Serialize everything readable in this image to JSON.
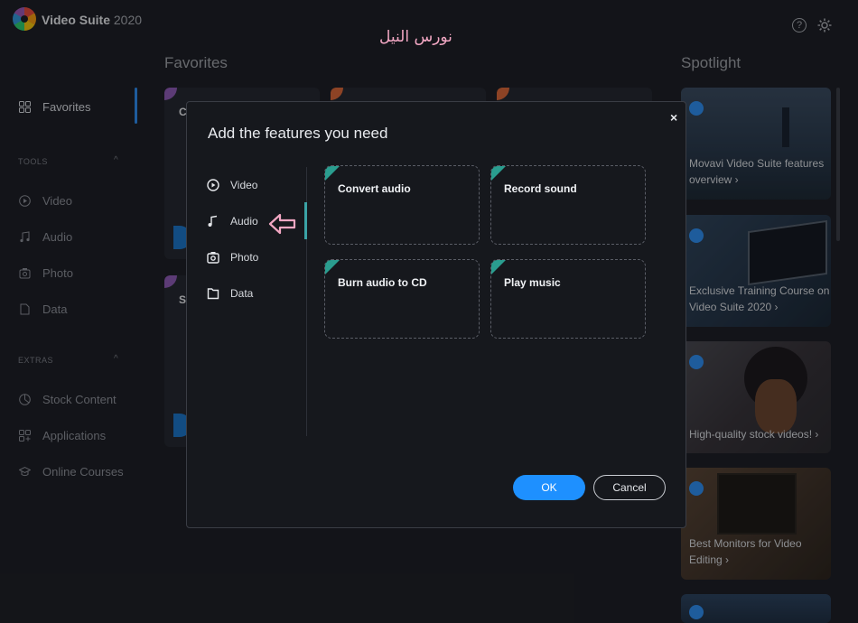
{
  "app": {
    "name": "Video Suite",
    "year": "2020"
  },
  "header": {
    "help_icon": "help-icon",
    "settings_icon": "gear-icon"
  },
  "watermark": "نورس النيل",
  "sidebar": {
    "favorites_label": "Favorites",
    "tools_section": "TOOLS",
    "tools": [
      {
        "label": "Video",
        "icon": "play-circle-icon"
      },
      {
        "label": "Audio",
        "icon": "music-note-icon"
      },
      {
        "label": "Photo",
        "icon": "camera-icon"
      },
      {
        "label": "Data",
        "icon": "file-icon"
      }
    ],
    "extras_section": "EXTRAS",
    "extras": [
      {
        "label": "Stock Content",
        "icon": "pie-chart-icon"
      },
      {
        "label": "Applications",
        "icon": "apps-plus-icon"
      },
      {
        "label": "Online Courses",
        "icon": "graduation-cap-icon"
      }
    ]
  },
  "main": {
    "favorites_title": "Favorites",
    "cards": [
      {
        "initial": "C"
      },
      {
        "initial": "Sp"
      }
    ]
  },
  "spotlight": {
    "title": "Spotlight",
    "items": [
      {
        "line1": "Movavi Video Suite features",
        "line2": "overview ›"
      },
      {
        "line1": "Exclusive Training Course on",
        "line2": "Video Suite 2020 ›"
      },
      {
        "line1": "High-quality stock videos! ›",
        "line2": ""
      },
      {
        "line1": "Best Monitors for Video",
        "line2": "Editing ›"
      }
    ]
  },
  "modal": {
    "title": "Add the features you need",
    "close": "×",
    "categories": [
      {
        "label": "Video",
        "icon": "play-circle-icon"
      },
      {
        "label": "Audio",
        "icon": "music-note-icon",
        "selected": true
      },
      {
        "label": "Photo",
        "icon": "camera-icon"
      },
      {
        "label": "Data",
        "icon": "file-icon"
      }
    ],
    "features": [
      {
        "label": "Convert audio"
      },
      {
        "label": "Record sound"
      },
      {
        "label": "Burn audio to CD"
      },
      {
        "label": "Play music"
      }
    ],
    "ok": "OK",
    "cancel": "Cancel"
  },
  "colors": {
    "accent": "#1e90ff",
    "teal": "#2a9d8f",
    "annotation": "#f2a7c3"
  }
}
